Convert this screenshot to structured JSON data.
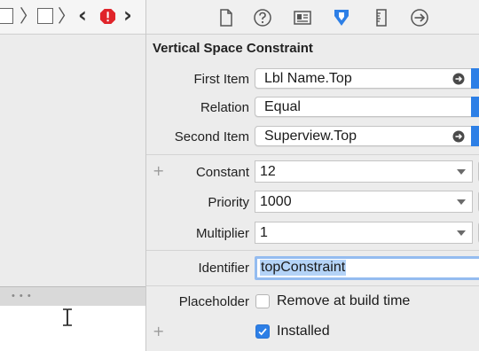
{
  "left_pane": {
    "split_dots": "• • •"
  },
  "inspector": {
    "tabs": [
      {
        "icon": "file-icon"
      },
      {
        "icon": "quick-help-icon"
      },
      {
        "icon": "identity-icon"
      },
      {
        "icon": "attributes-icon",
        "selected": true
      },
      {
        "icon": "size-icon"
      },
      {
        "icon": "connections-icon"
      }
    ],
    "accent_color": "#2d7fe6",
    "section_title": "Vertical Space Constraint",
    "first_item": {
      "label": "First Item",
      "value": "Lbl Name.Top"
    },
    "relation": {
      "label": "Relation",
      "value": "Equal"
    },
    "second_item": {
      "label": "Second Item",
      "value": "Superview.Top"
    },
    "constant": {
      "label": "Constant",
      "value": "12"
    },
    "priority": {
      "label": "Priority",
      "value": "1000"
    },
    "multiplier": {
      "label": "Multiplier",
      "value": "1"
    },
    "identifier": {
      "label": "Identifier",
      "value": "topConstraint"
    },
    "placeholder": {
      "label": "Placeholder",
      "checkbox_label": "Remove at build time",
      "checked": false
    },
    "installed": {
      "checkbox_label": "Installed",
      "checked": true
    },
    "plus_symbol": "+"
  }
}
